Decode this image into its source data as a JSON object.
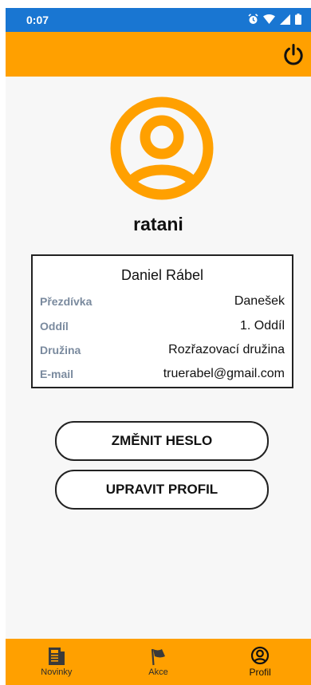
{
  "status_bar": {
    "time": "0:07",
    "icons": [
      "alarm-icon",
      "wifi-icon",
      "signal-icon",
      "battery-icon"
    ]
  },
  "app_bar": {
    "action_icon": "power-icon"
  },
  "profile": {
    "username": "ratani",
    "full_name": "Daniel Rábel",
    "fields": [
      {
        "label": "Přezdívka",
        "value": "Danešek"
      },
      {
        "label": "Oddíl",
        "value": "1. Oddíl"
      },
      {
        "label": "Družina",
        "value": "Rozřazovací družina"
      },
      {
        "label": "E-mail",
        "value": "truerabel@gmail.com"
      }
    ]
  },
  "actions": {
    "change_password": "ZMĚNIT HESLO",
    "edit_profile": "UPRAVIT PROFIL"
  },
  "bottom_nav": {
    "items": [
      {
        "label": "Novinky",
        "icon": "newspaper-icon"
      },
      {
        "label": "Akce",
        "icon": "flag-icon"
      },
      {
        "label": "Profil",
        "icon": "profile-icon",
        "active": true
      }
    ]
  },
  "colors": {
    "status_bar": "#1976d2",
    "accent": "#ffa000",
    "field_label": "#7a8a9e"
  }
}
